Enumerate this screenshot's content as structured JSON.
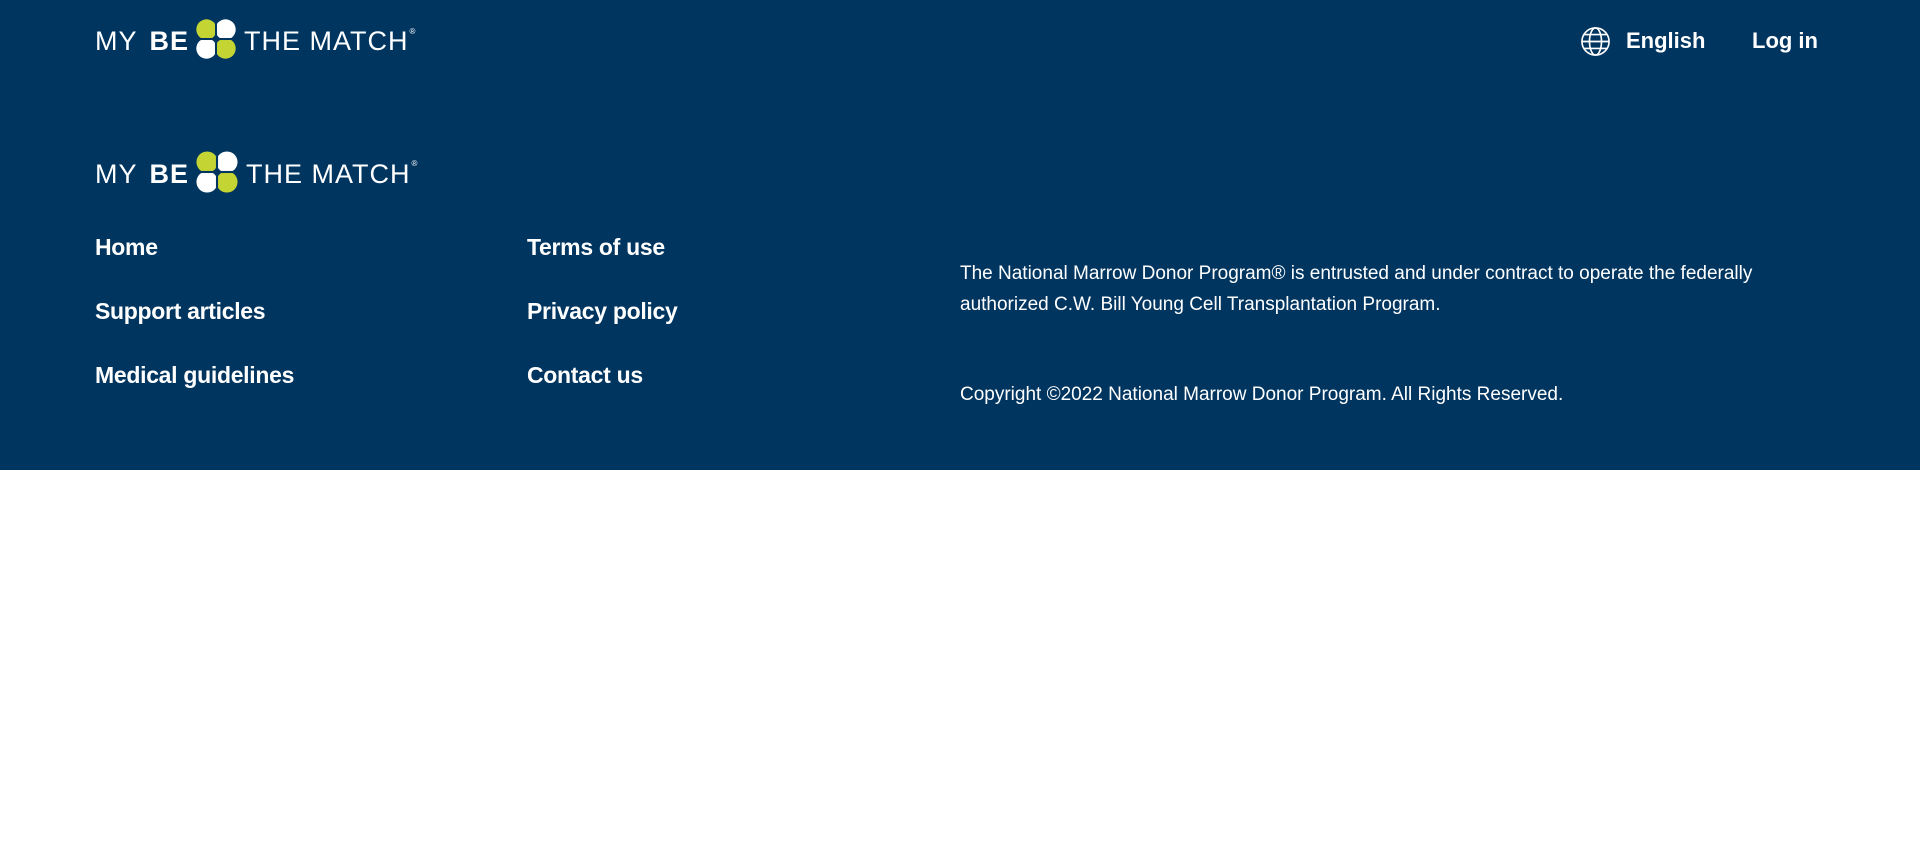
{
  "colors": {
    "brand_navy": "#003560",
    "brand_lime": "#c4d433",
    "text_on_dark": "#ffffff",
    "page_background": "#ffffff"
  },
  "header": {
    "logo": {
      "word_my": "MY",
      "word_be": "BE",
      "word_rest": "THE MATCH",
      "registered": "®",
      "icon": "clover-icon"
    },
    "language": {
      "icon": "globe-icon",
      "label": "English"
    },
    "login_label": "Log in"
  },
  "footer": {
    "logo": {
      "word_my": "MY",
      "word_be": "BE",
      "word_rest": "THE MATCH",
      "registered": "®",
      "icon": "clover-icon"
    },
    "links_column_1": [
      {
        "label": "Home"
      },
      {
        "label": "Support articles"
      },
      {
        "label": "Medical guidelines"
      }
    ],
    "links_column_2": [
      {
        "label": "Terms of use"
      },
      {
        "label": "Privacy policy"
      },
      {
        "label": "Contact us"
      }
    ],
    "legal_text": "The National Marrow Donor Program® is entrusted and under contract to operate the federally authorized C.W. Bill Young Cell Transplantation Program.",
    "copyright": "Copyright ©2022 National Marrow Donor Program. All Rights Reserved."
  }
}
